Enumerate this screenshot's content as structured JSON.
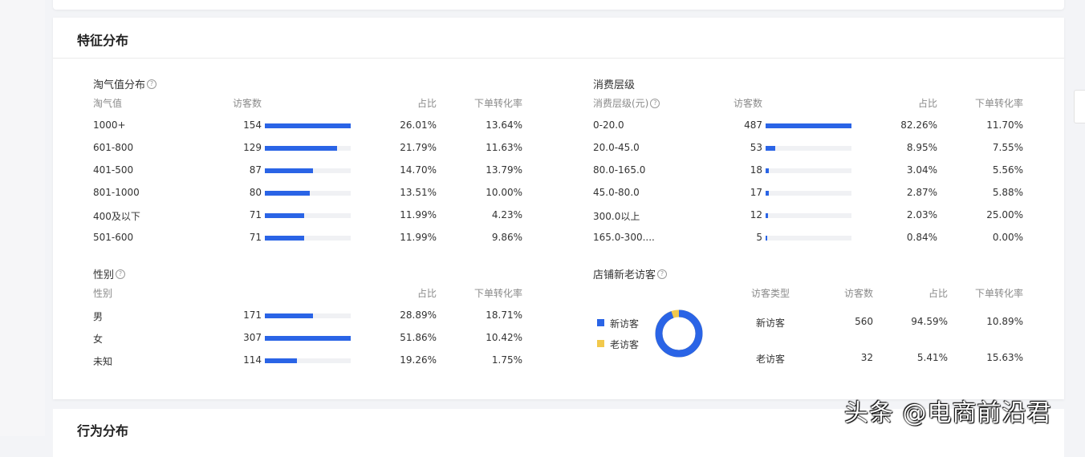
{
  "section_title": "特征分布",
  "next_section_title": "行为分布",
  "taoqi": {
    "title": "淘气值分布",
    "headers": [
      "淘气值",
      "访客数",
      "占比",
      "下单转化率"
    ],
    "rows": [
      {
        "label": "1000+",
        "visitors": "154",
        "ratio": "26.01%",
        "conversion": "13.64%",
        "bar": 1.0
      },
      {
        "label": "601-800",
        "visitors": "129",
        "ratio": "21.79%",
        "conversion": "11.63%",
        "bar": 0.84
      },
      {
        "label": "401-500",
        "visitors": "87",
        "ratio": "14.70%",
        "conversion": "13.79%",
        "bar": 0.56
      },
      {
        "label": "801-1000",
        "visitors": "80",
        "ratio": "13.51%",
        "conversion": "10.00%",
        "bar": 0.52
      },
      {
        "label": "400及以下",
        "visitors": "71",
        "ratio": "11.99%",
        "conversion": "4.23%",
        "bar": 0.46
      },
      {
        "label": "501-600",
        "visitors": "71",
        "ratio": "11.99%",
        "conversion": "9.86%",
        "bar": 0.46
      }
    ]
  },
  "spend": {
    "title": "消费层级",
    "headers": [
      "消费层级(元)",
      "访客数",
      "占比",
      "下单转化率"
    ],
    "rows": [
      {
        "label": "0-20.0",
        "visitors": "487",
        "ratio": "82.26%",
        "conversion": "11.70%",
        "bar": 1.0
      },
      {
        "label": "20.0-45.0",
        "visitors": "53",
        "ratio": "8.95%",
        "conversion": "7.55%",
        "bar": 0.11
      },
      {
        "label": "80.0-165.0",
        "visitors": "18",
        "ratio": "3.04%",
        "conversion": "5.56%",
        "bar": 0.037
      },
      {
        "label": "45.0-80.0",
        "visitors": "17",
        "ratio": "2.87%",
        "conversion": "5.88%",
        "bar": 0.035
      },
      {
        "label": "300.0以上",
        "visitors": "12",
        "ratio": "2.03%",
        "conversion": "25.00%",
        "bar": 0.025
      },
      {
        "label": "165.0-300....",
        "visitors": "5",
        "ratio": "0.84%",
        "conversion": "0.00%",
        "bar": 0.01
      }
    ]
  },
  "gender": {
    "title": "性别",
    "headers": [
      "性别",
      "占比",
      "下单转化率"
    ],
    "rows": [
      {
        "label": "男",
        "visitors": "171",
        "ratio": "28.89%",
        "conversion": "18.71%",
        "bar": 0.56
      },
      {
        "label": "女",
        "visitors": "307",
        "ratio": "51.86%",
        "conversion": "10.42%",
        "bar": 1.0
      },
      {
        "label": "未知",
        "visitors": "114",
        "ratio": "19.26%",
        "conversion": "1.75%",
        "bar": 0.37
      }
    ]
  },
  "newold": {
    "title": "店铺新老访客",
    "legend": [
      {
        "label": "新访客",
        "color": "#2a64e6"
      },
      {
        "label": "老访客",
        "color": "#f2c94c"
      }
    ],
    "donut_fraction_new": 0.9459,
    "headers": [
      "访客类型",
      "访客数",
      "占比",
      "下单转化率"
    ],
    "rows": [
      {
        "label": "新访客",
        "visitors": "560",
        "ratio": "94.59%",
        "conversion": "10.89%"
      },
      {
        "label": "老访客",
        "visitors": "32",
        "ratio": "5.41%",
        "conversion": "15.63%"
      }
    ]
  },
  "watermark": "头条 @电商前沿君",
  "colors": {
    "bar": "#2a64e6",
    "track": "#f0f1f4",
    "old_visitor": "#f2c94c"
  }
}
